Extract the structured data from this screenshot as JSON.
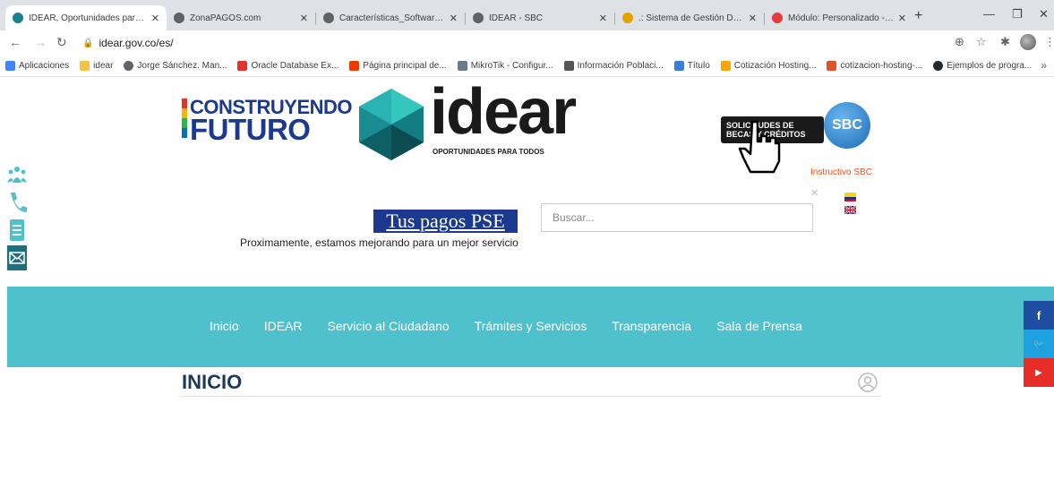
{
  "browser": {
    "tabs": [
      {
        "label": "IDEAR, Oportunidades para To",
        "active": true,
        "icon_color": "#1a7f8f"
      },
      {
        "label": "ZonaPAGOS.com",
        "active": false,
        "icon_color": "#5f6368"
      },
      {
        "label": "Características_Software_SBC_p",
        "active": false,
        "icon_color": "#5f6368"
      },
      {
        "label": "IDEAR - SBC",
        "active": false,
        "icon_color": "#5f6368"
      },
      {
        "label": ".: Sistema de Gestión Documen",
        "active": false,
        "icon_color": "#e8a200"
      },
      {
        "label": "Módulo: Personalizado - IDEAR",
        "active": false,
        "icon_color": "#e43b3b"
      }
    ],
    "url": "idear.gov.co/es/",
    "bookmarks": [
      {
        "label": "Aplicaciones",
        "icon_color": "#4285f4"
      },
      {
        "label": "idear",
        "icon_color": "#f6c342"
      },
      {
        "label": "Jorge Sánchez. Man...",
        "icon_color": "#5f6368"
      },
      {
        "label": "Oracle Database Ex...",
        "icon_color": "#e3342f"
      },
      {
        "label": "Página principal de...",
        "icon_color": "#eb3c00"
      },
      {
        "label": "MikroTik - Configur...",
        "icon_color": "#6b7b8c"
      },
      {
        "label": "Información Poblaci...",
        "icon_color": "#555555"
      },
      {
        "label": "Título",
        "icon_color": "#3b7dd8"
      },
      {
        "label": "Cotización Hosting...",
        "icon_color": "#f7a600"
      },
      {
        "label": "cotizacion-hosting-...",
        "icon_color": "#e0512c"
      },
      {
        "label": "Ejemplos de progra...",
        "icon_color": "#24292e"
      }
    ]
  },
  "header": {
    "logo_cf_line1": "CONSTRUYENDO",
    "logo_cf_line2": "FUTURO",
    "logo_word": "idear",
    "logo_tagline": "OPORTUNIDADES PARA TODOS",
    "sbc_banner_text": "SOLICITUDES DE BECAS Y CRÉDITOS",
    "sbc_badge": "SBC",
    "sbc_link": "Instructivo SBC",
    "pse_label": "Tus pagos PSE",
    "notice": "Proximamente, estamos mejorando para un mejor servicio",
    "search_placeholder": "Buscar..."
  },
  "nav": {
    "items": [
      "Inicio",
      "IDEAR",
      "Servicio al Ciudadano",
      "Trámites y Servicios",
      "Transparencia",
      "Sala de Prensa"
    ],
    "color": "#4fc1cc"
  },
  "main": {
    "heading": "INICIO"
  },
  "colors": {
    "brand_blue": "#1b3a8f",
    "accent_orange": "#e8501a",
    "facebook": "#1f4ea1",
    "twitter": "#1da1e0",
    "youtube": "#e62d27"
  }
}
